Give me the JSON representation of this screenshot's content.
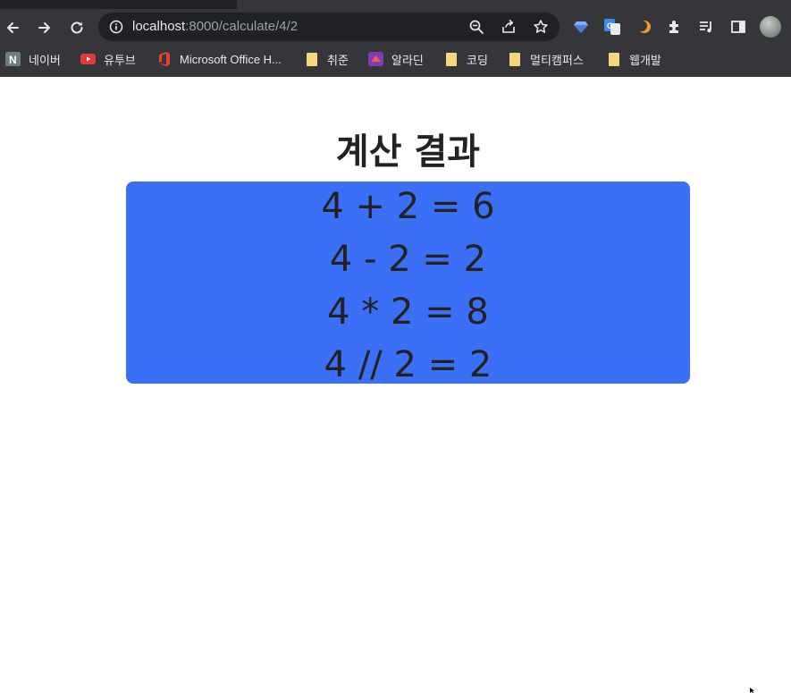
{
  "browser": {
    "url_host": "localhost",
    "url_path": ":8000/calculate/4/2",
    "bookmarks": [
      {
        "label": "네이버",
        "icon": "naver-icon"
      },
      {
        "label": "유투브",
        "icon": "youtube-icon"
      },
      {
        "label": "Microsoft Office H...",
        "icon": "office-icon"
      },
      {
        "label": "취준",
        "icon": "folder-icon"
      },
      {
        "label": "알라딘",
        "icon": "aladin-icon"
      },
      {
        "label": "코딩",
        "icon": "folder-icon"
      },
      {
        "label": "멀티캠퍼스",
        "icon": "folder-icon"
      },
      {
        "label": "웹개발",
        "icon": "folder-icon"
      }
    ],
    "colors": {
      "toolbar": "#35363a",
      "omnibox": "#202124",
      "folder": "#f6d77a"
    }
  },
  "page": {
    "title": "계산 결과",
    "results": [
      "4 + 2 = 6",
      "4 - 2 = 2",
      "4 * 2 = 8",
      "4 // 2 = 2"
    ],
    "colors": {
      "result_box": "#3b6ff5",
      "text": "#222222"
    }
  }
}
